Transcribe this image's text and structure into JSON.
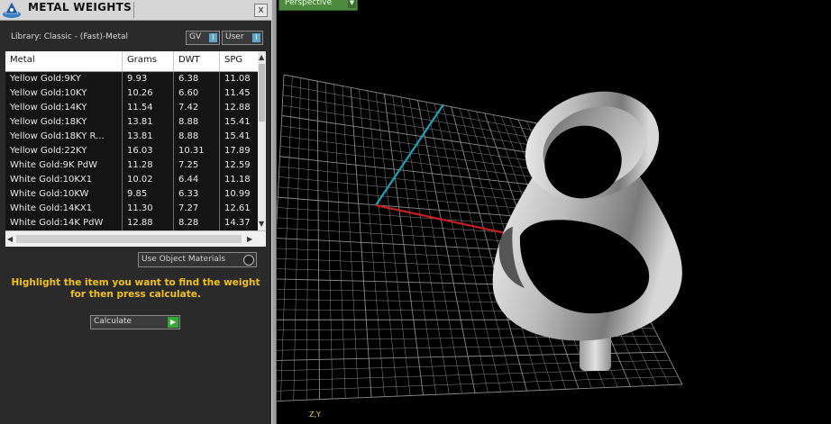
{
  "panel": {
    "title": "METAL WEIGHTS",
    "close_label": "x",
    "library": "Library: Classic - (Fast)-Metal",
    "gv_label": "GV",
    "user_label": "User",
    "toggle_glyph": "I",
    "table": {
      "headers": [
        "Metal",
        "Grams",
        "DWT",
        "SPG"
      ],
      "rows": [
        [
          "Yellow Gold:9KY",
          "9.93",
          "6.38",
          "11.08"
        ],
        [
          "Yellow Gold:10KY",
          "10.26",
          "6.60",
          "11.45"
        ],
        [
          "Yellow Gold:14KY",
          "11.54",
          "7.42",
          "12.88"
        ],
        [
          "Yellow Gold:18KY",
          "13.81",
          "8.88",
          "15.41"
        ],
        [
          "Yellow Gold:18KY R...",
          "13.81",
          "8.88",
          "15.41"
        ],
        [
          "Yellow Gold:22KY",
          "16.03",
          "10.31",
          "17.89"
        ],
        [
          "White Gold:9K PdW",
          "11.28",
          "7.25",
          "12.59"
        ],
        [
          "White Gold:10KX1",
          "10.02",
          "6.44",
          "11.18"
        ],
        [
          "White Gold:10KW",
          "9.85",
          "6.33",
          "10.99"
        ],
        [
          "White Gold:14KX1",
          "11.30",
          "7.27",
          "12.61"
        ],
        [
          "White Gold:14K PdW",
          "12.88",
          "8.28",
          "14.37"
        ]
      ]
    },
    "use_object_materials_label": "Use Object Materials",
    "hint": "Highlight the item you want to find the weight for then press calculate.",
    "calculate_label": "Calculate",
    "calculate_glyph": "▶"
  },
  "viewport": {
    "view_label": "Perspective",
    "view_arrow": "▼",
    "axis_label": "Z,Y"
  },
  "colors": {
    "grid": "#8a8a8a",
    "x_axis": "#c42020",
    "y_axis": "#1fa3b8",
    "hint": "#f2c21a"
  }
}
